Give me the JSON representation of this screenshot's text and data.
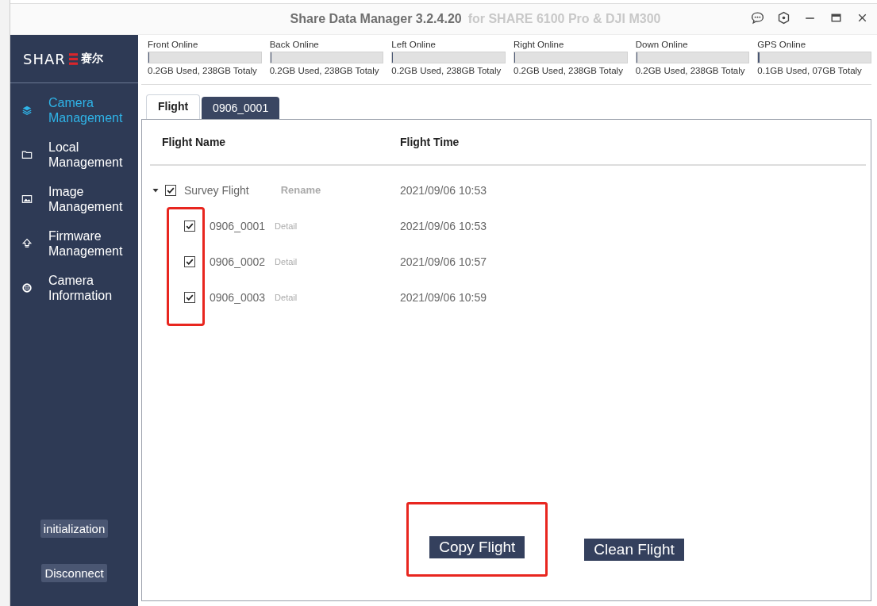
{
  "window": {
    "title": "Share Data Manager 3.2.4.20",
    "subtitle": "for SHARE 6100 Pro & DJI M300"
  },
  "logo": {
    "text": "SHAR",
    "text_cn": "赛尔"
  },
  "sidebar": {
    "items": [
      {
        "label": "Camera Management",
        "selected": true
      },
      {
        "label": "Local Management",
        "selected": false
      },
      {
        "label": "Image Management",
        "selected": false
      },
      {
        "label": "Firmware Management",
        "selected": false
      },
      {
        "label": "Camera Information",
        "selected": false
      }
    ],
    "buttons": [
      "initialization",
      "Disconnect"
    ]
  },
  "storage": [
    {
      "name": "Front Online",
      "level": 0.001,
      "usage": "0.2GB Used, 238GB Totaly"
    },
    {
      "name": "Back Online",
      "level": 0.001,
      "usage": "0.2GB Used, 238GB Totaly"
    },
    {
      "name": "Left Online",
      "level": 0.001,
      "usage": "0.2GB Used, 238GB Totaly"
    },
    {
      "name": "Right Online",
      "level": 0.001,
      "usage": "0.2GB Used, 238GB Totaly"
    },
    {
      "name": "Down Online",
      "level": 0.001,
      "usage": "0.2GB Used, 238GB Totaly"
    },
    {
      "name": "GPS Online",
      "level": 0.014,
      "usage": "0.1GB Used, 07GB Totaly"
    }
  ],
  "tabs": [
    {
      "label": "Flight",
      "selected": true
    },
    {
      "label": "0906_0001",
      "selected": false
    }
  ],
  "table": {
    "columns": [
      "Flight Name",
      "Flight Time"
    ],
    "rows": [
      {
        "name": "Survey Flight",
        "action": "Rename",
        "time": "2021/09/06 10:53",
        "checked": true,
        "expanded": true,
        "children": [
          {
            "name": "0906_0001",
            "action": "Detail",
            "time": "2021/09/06 10:53",
            "checked": true
          },
          {
            "name": "0906_0002",
            "action": "Detail",
            "time": "2021/09/06 10:57",
            "checked": true
          },
          {
            "name": "0906_0003",
            "action": "Detail",
            "time": "2021/09/06 10:59",
            "checked": true
          }
        ],
        "children_highlighted": true
      }
    ]
  },
  "actions": [
    {
      "label": "Copy Flight",
      "highlighted": true
    },
    {
      "label": "Clean Flight",
      "highlighted": false
    }
  ]
}
